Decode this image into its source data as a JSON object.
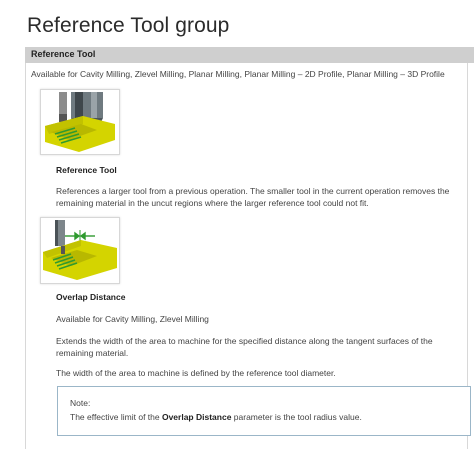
{
  "page": {
    "title": "Reference Tool group"
  },
  "section": {
    "label": "Reference Tool",
    "availability": "Available for Cavity Milling, Zlevel Milling, Planar Milling, Planar Milling – 2D Profile, Planar Milling – 3D Profile"
  },
  "reference_tool": {
    "heading": "Reference Tool",
    "description": "References a larger tool from a previous operation. The smaller tool in the current operation removes the remaining material in the uncut regions where the larger reference tool could not fit.",
    "image_icon": "reference-tool-illustration-icon"
  },
  "overlap_distance": {
    "heading": "Overlap Distance",
    "availability": "Available for Cavity Milling, Zlevel Milling",
    "description": "Extends the width of the area to machine for the specified distance along the tangent surfaces of the remaining material.",
    "width_note": "The width of the area to machine is defined by the reference tool diameter.",
    "image_icon": "overlap-distance-illustration-icon"
  },
  "note": {
    "label": "Note:",
    "text_before": "The effective limit of the ",
    "text_bold": "Overlap Distance",
    "text_after": " parameter is the tool radius value."
  },
  "colors": {
    "section_bar": "#cfcfcf",
    "note_border": "#9bb6c8",
    "part_yellow": "#d4d400",
    "toolpath_green": "#2f9a2f"
  }
}
